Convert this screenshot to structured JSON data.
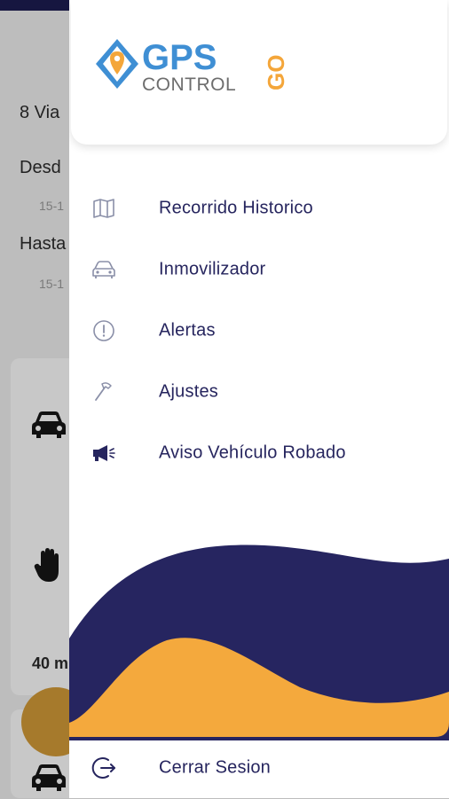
{
  "background": {
    "trip_count_text": "8 Via",
    "from_label": "Desd",
    "from_date": "15-1",
    "to_label": "Hasta",
    "to_date": "15-1",
    "duration_text": "40 m"
  },
  "drawer": {
    "logo": {
      "primary_text": "GPS",
      "secondary_text": "CONTROL",
      "badge_text": "GO",
      "colors": {
        "blue": "#3f8fd4",
        "orange": "#f4a63a",
        "gray": "#6d6d6d",
        "navy": "#2a2860"
      }
    },
    "menu_items": [
      {
        "label": "Recorrido Historico",
        "icon": "map-icon"
      },
      {
        "label": "Inmovilizador",
        "icon": "car-icon"
      },
      {
        "label": "Alertas",
        "icon": "alert-circle-icon"
      },
      {
        "label": "Ajustes",
        "icon": "hammer-icon"
      },
      {
        "label": "Aviso Vehículo Robado",
        "icon": "megaphone-icon"
      }
    ],
    "logout_label": "Cerrar Sesion",
    "logout_icon": "logout-icon",
    "colors": {
      "text": "#26255e",
      "wave_navy": "#262560",
      "wave_orange": "#f4a93d",
      "icon_gray": "#8a8fa8"
    }
  }
}
